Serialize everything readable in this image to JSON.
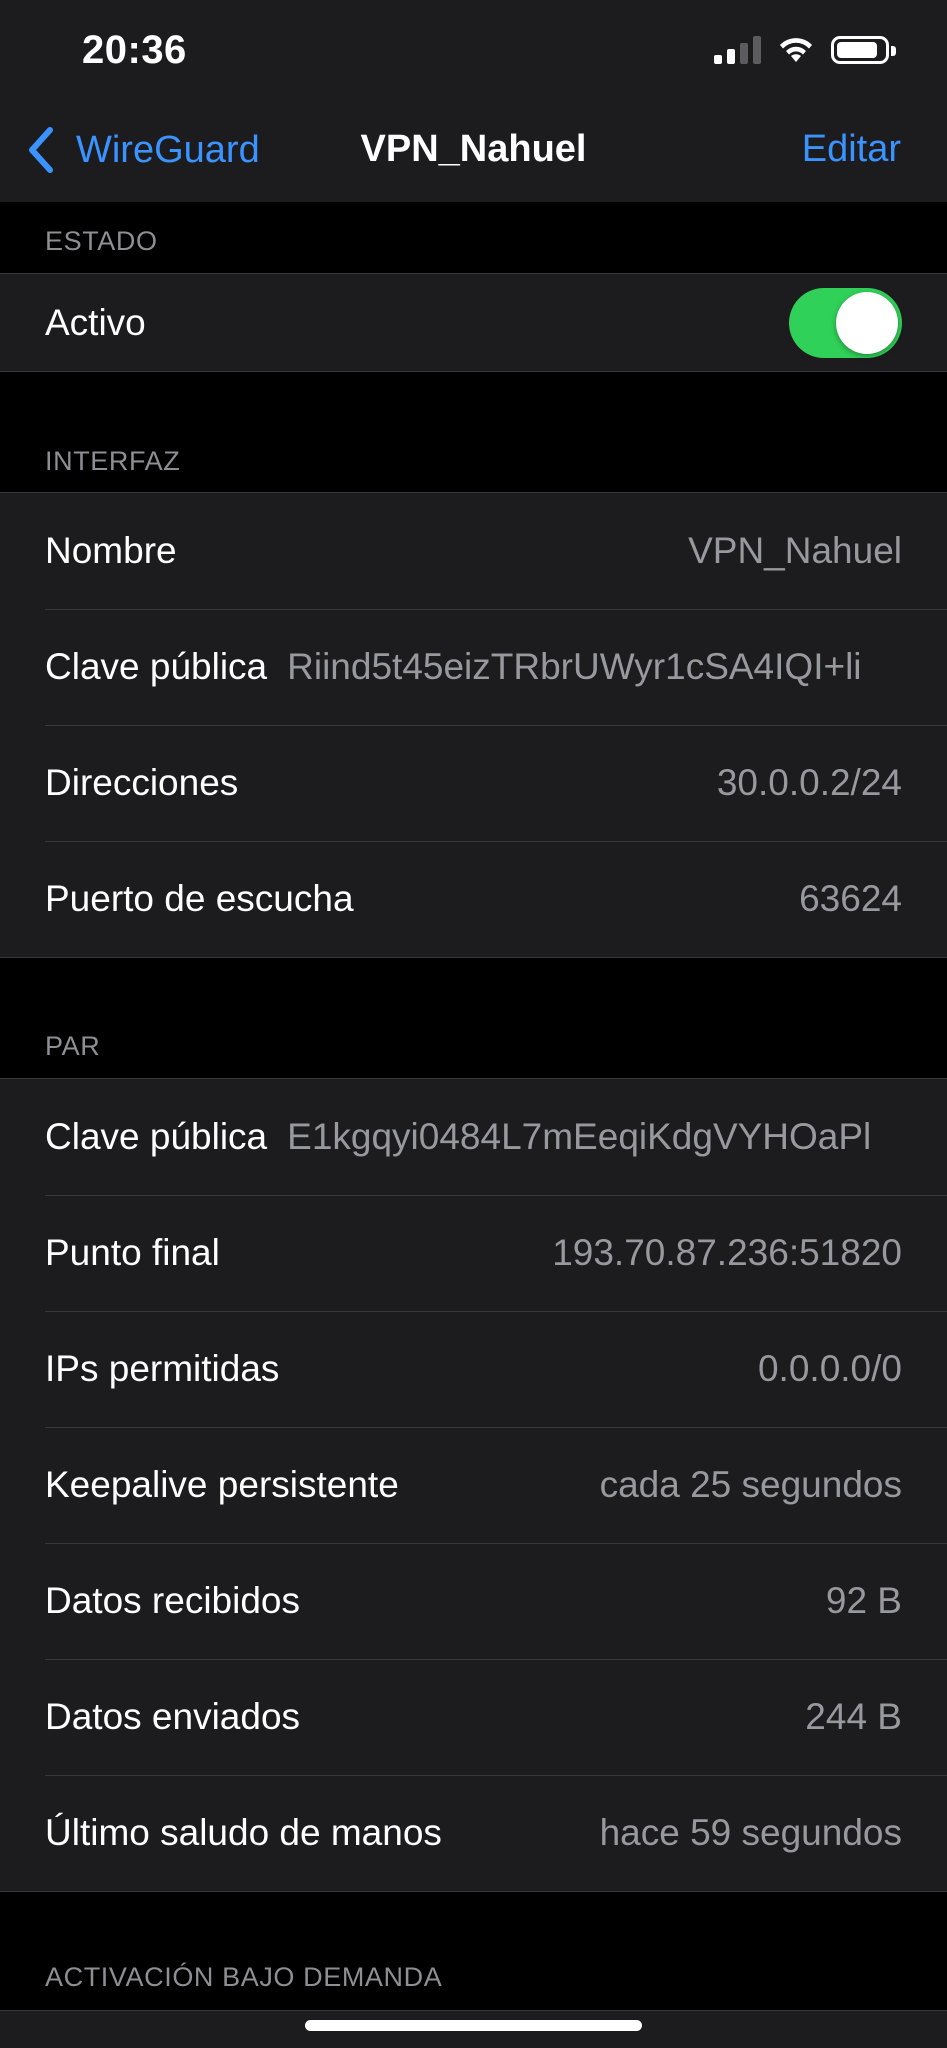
{
  "status_bar": {
    "time": "20:36",
    "signal_icon": "cellular-signal-icon",
    "wifi_icon": "wifi-icon",
    "battery_icon": "battery-icon"
  },
  "nav": {
    "back_icon": "chevron-left-icon",
    "back_label": "WireGuard",
    "title": "VPN_Nahuel",
    "edit_label": "Editar"
  },
  "estado": {
    "header": "ESTADO",
    "active_label": "Activo",
    "active_on": true
  },
  "interfaz": {
    "header": "INTERFAZ",
    "rows": [
      {
        "label": "Nombre",
        "value": "VPN_Nahuel"
      },
      {
        "label": "Clave pública",
        "value": "Riind5t45eizTRbrUWyr1cSA4IQI+li"
      },
      {
        "label": "Direcciones",
        "value": "30.0.0.2/24"
      },
      {
        "label": "Puerto de escucha",
        "value": "63624"
      }
    ]
  },
  "par": {
    "header": "PAR",
    "rows": [
      {
        "label": "Clave pública",
        "value": "E1kgqyi0484L7mEeqiKdgVYHOaPl"
      },
      {
        "label": "Punto final",
        "value": "193.70.87.236:51820"
      },
      {
        "label": "IPs permitidas",
        "value": "0.0.0.0/0"
      },
      {
        "label": "Keepalive persistente",
        "value": "cada 25 segundos"
      },
      {
        "label": "Datos recibidos",
        "value": "92 B"
      },
      {
        "label": "Datos enviados",
        "value": "244 B"
      },
      {
        "label": "Último saludo de manos",
        "value": "hace 59 segundos"
      }
    ]
  },
  "activacion": {
    "header": "ACTIVACIÓN BAJO DEMANDA"
  },
  "colors": {
    "accent": "#3a93ff",
    "toggle_on": "#30d158",
    "cell_bg": "#1c1c1e",
    "page_bg": "#000000",
    "secondary_text": "#98989f"
  }
}
